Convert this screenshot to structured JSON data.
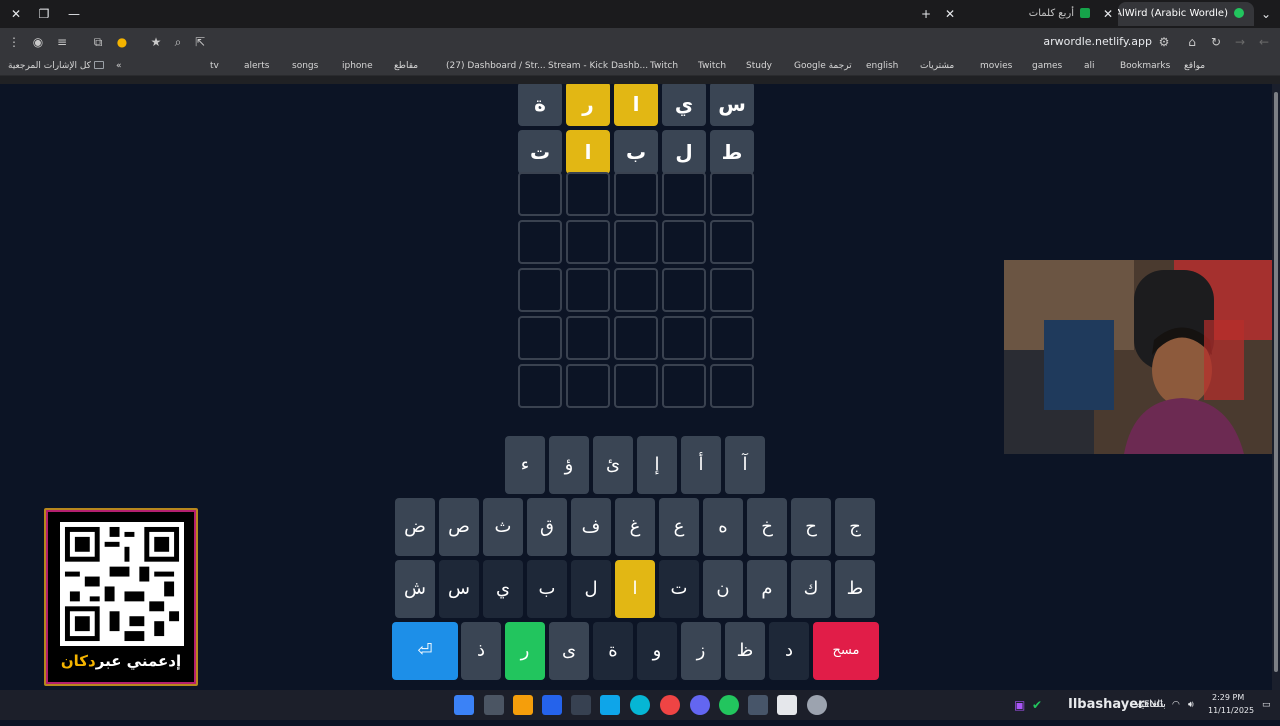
{
  "window": {
    "tabs": [
      {
        "label": "AlWird (Arabic Wordle) - الورد",
        "active": true
      },
      {
        "label": "أربع كلمات",
        "active": false
      }
    ]
  },
  "toolbar": {
    "url": "arwordle.netlify.app"
  },
  "bookmarks": {
    "items": [
      "مواقع",
      "Bookmarks",
      "ali",
      "games",
      "movies",
      "مشتريات",
      "english",
      "Google ترجمة",
      "Study",
      "Twitch",
      "Twitch",
      "Stream - Kick Dashb...",
      "(27) Dashboard / Str...",
      "مقاطع",
      "iphone",
      "songs",
      "alerts",
      "tv"
    ],
    "all_bookmarks": "كل الإشارات المرجعية"
  },
  "grid": {
    "rows": [
      {
        "cells": [
          {
            "l": "س",
            "s": "gray"
          },
          {
            "l": "ي",
            "s": "gray"
          },
          {
            "l": "ا",
            "s": "yellow"
          },
          {
            "l": "ر",
            "s": "yellow"
          },
          {
            "l": "ة",
            "s": "gray"
          }
        ]
      },
      {
        "cells": [
          {
            "l": "ط",
            "s": "gray"
          },
          {
            "l": "ل",
            "s": "gray"
          },
          {
            "l": "ب",
            "s": "gray"
          },
          {
            "l": "ا",
            "s": "yellow"
          },
          {
            "l": "ت",
            "s": "gray"
          }
        ]
      }
    ],
    "empty_rows": 5
  },
  "keyboard": {
    "row1": [
      "آ",
      "أ",
      "إ",
      "ئ",
      "ؤ",
      "ء"
    ],
    "row2": [
      "ج",
      "ح",
      "خ",
      "ه",
      "ع",
      "غ",
      "ف",
      "ق",
      "ث",
      "ص",
      "ض"
    ],
    "row3": [
      "ط",
      "ك",
      "م",
      "ن",
      "ت",
      "ا",
      "ل",
      "ب",
      "ي",
      "س",
      "ش"
    ],
    "row4": [
      "مسح",
      "د",
      "ظ",
      "ز",
      "و",
      "ة",
      "ى",
      "ر",
      "ذ",
      "⏎"
    ],
    "yellow_key": "ا",
    "green_key": "ر"
  },
  "qr": {
    "label_pre": "إدعمني عبر",
    "label_brand": "دكان"
  },
  "taskbar": {
    "streamer": "Ilbashayer",
    "tray_text": "بالعافيه",
    "lang": "ENG",
    "time": "2:29 PM",
    "date": "11/11/2025"
  },
  "colors": {
    "gray": "#3a4554",
    "yellow": "#e2b714",
    "green": "#22c55e",
    "blue": "#1d8fe8",
    "red": "#e11d48"
  }
}
